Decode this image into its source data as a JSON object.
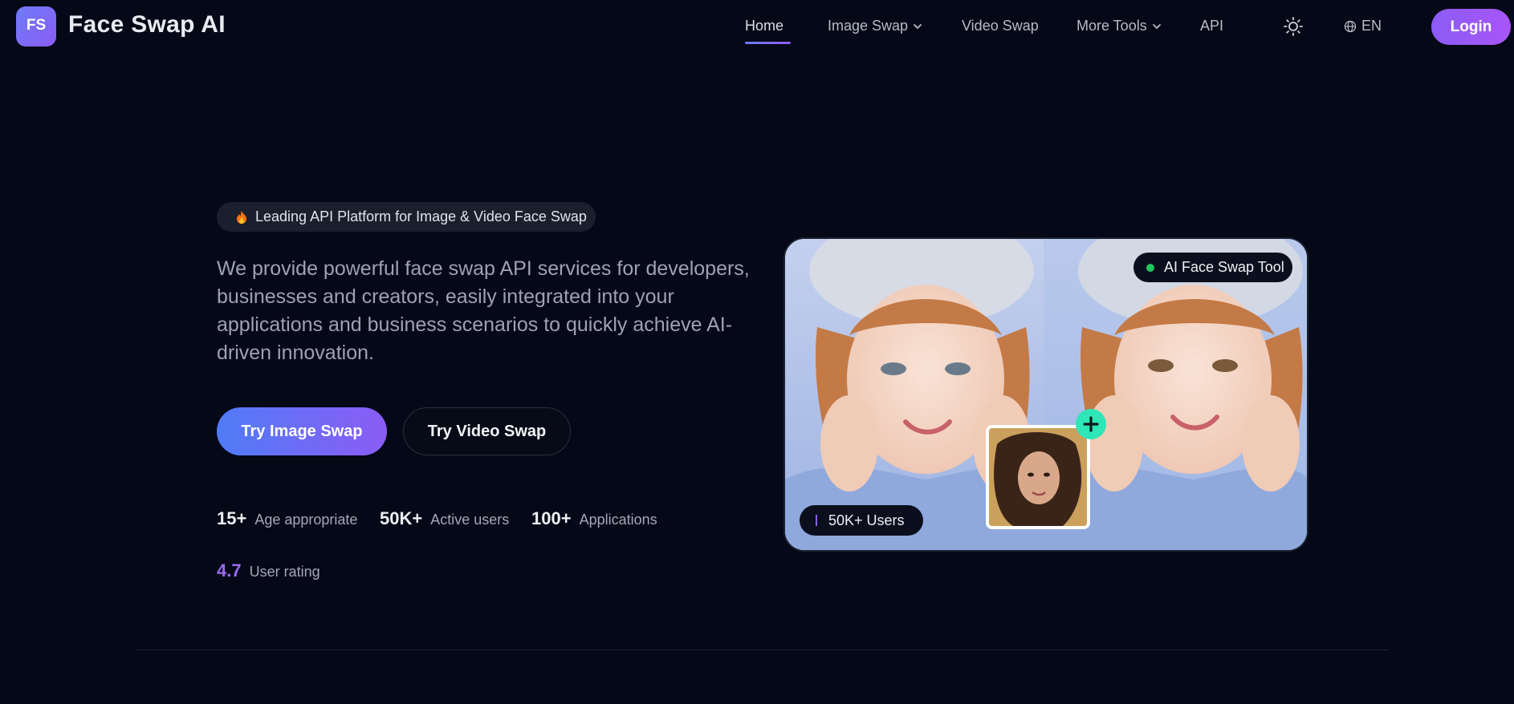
{
  "brand": {
    "logo_text": "FS",
    "name": "Face Swap AI"
  },
  "nav": {
    "items": [
      {
        "label": "Home",
        "active": true,
        "dropdown": false
      },
      {
        "label": "Image Swap",
        "active": false,
        "dropdown": true
      },
      {
        "label": "Video Swap",
        "active": false,
        "dropdown": false
      },
      {
        "label": "More Tools",
        "active": false,
        "dropdown": true
      },
      {
        "label": "API",
        "active": false,
        "dropdown": false
      }
    ],
    "theme_icon": "sun-icon",
    "language": "EN",
    "login_label": "Login"
  },
  "hero": {
    "badge": {
      "icon": "fire-icon",
      "text": "Leading API Platform for Image & Video Face Swap"
    },
    "description": "We provide powerful face swap API services for developers, businesses and creators, easily integrated into your applications and business scenarios to quickly achieve AI-driven innovation.",
    "primary_cta": "Try Image Swap",
    "secondary_cta": "Try Video Swap",
    "stats": [
      {
        "value": "15+",
        "label": "Age appropriate"
      },
      {
        "value": "50K+",
        "label": "Active users"
      },
      {
        "value": "100+",
        "label": "Applications"
      },
      {
        "value": "4.7",
        "label": "User rating"
      }
    ]
  },
  "showcase": {
    "tool_tag": "AI Face Swap Tool",
    "users_tag": "50K+ Users"
  },
  "colors": {
    "background": "#050816",
    "accent_start": "#4f7cf7",
    "accent_end": "#8b5cf6",
    "status_green": "#22c55e",
    "plus_badge": "#2ee6b8"
  }
}
